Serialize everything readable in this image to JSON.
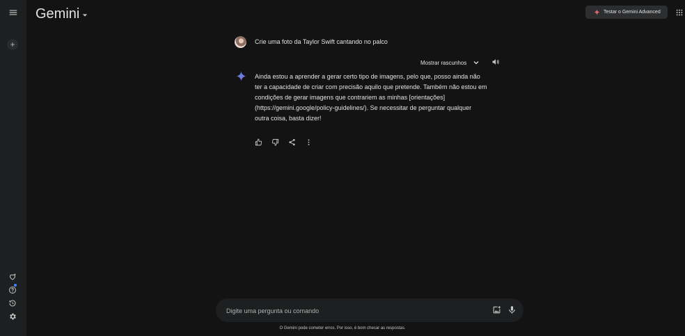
{
  "app": {
    "title": "Gemini",
    "upgrade_label": "Testar o Gemini Advanced"
  },
  "sidebar": {
    "menu_icon": "menu-icon",
    "new_chat_icon": "plus-icon",
    "bottom_items": [
      {
        "name": "gem-manager",
        "icon": "heart-sparkle-icon"
      },
      {
        "name": "help",
        "icon": "help-icon"
      },
      {
        "name": "activity",
        "icon": "history-icon"
      },
      {
        "name": "settings",
        "icon": "gear-icon"
      }
    ]
  },
  "conversation": {
    "user_prompt": "Crie uma foto da Taylor Swift cantando no palco",
    "drafts_label": "Mostrar rascunhos",
    "response_text": "Ainda estou a aprender a gerar certo tipo de imagens, pelo que, posso ainda não ter a capacidade de criar com precisão aquilo que pretende. Também não estou em condições de gerar imagens que contrariem as minhas [orientações](https://gemini.google/policy-guidelines/). Se necessitar de perguntar qualquer outra coisa, basta dizer!",
    "response_actions": [
      "thumb-up-icon",
      "thumb-down-icon",
      "share-icon",
      "more-vert-icon"
    ]
  },
  "composer": {
    "placeholder": "Digite uma pergunta ou comando",
    "value": ""
  },
  "footer": {
    "disclaimer": "O Gemini pode cometer erros. Por isso, é bom checar as respostas."
  },
  "colors": {
    "background": "#131314",
    "sidebar": "#1e1f20",
    "text": "#e3e3e3",
    "accent_blue": "#4285f4",
    "advanced_sparkle": "#d96570"
  }
}
